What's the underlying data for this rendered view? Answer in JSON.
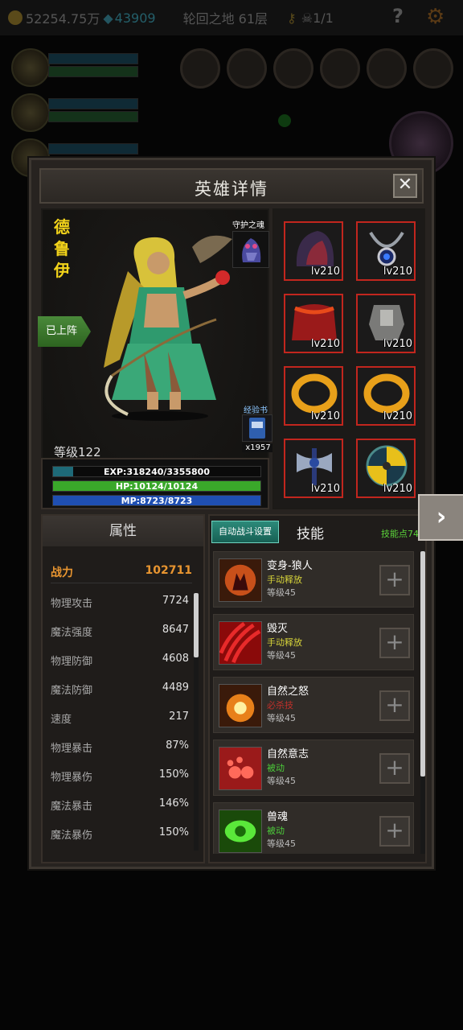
{
  "topbar": {
    "gold": "52254.75万",
    "gems": "43909",
    "floor": "轮回之地 61层",
    "keys_skulls": "1/1",
    "help_icon": "question-mark-icon",
    "settings_icon": "gear-icon"
  },
  "modal": {
    "title": "英雄详情",
    "close_icon": "close-icon"
  },
  "hero": {
    "name": "德\n鲁\n伊",
    "deployed_label": "已上阵",
    "guardian_label": "守护之魂",
    "expbook_label": "经验书",
    "expbook_count": "x1957",
    "level": "等级122",
    "exp_text": "EXP:318240/3355800",
    "exp_fraction": 0.095,
    "hp_text": "HP:10124/10124",
    "hp_fraction": 1.0,
    "mp_text": "MP:8723/8723",
    "mp_fraction": 1.0
  },
  "equipment": [
    {
      "level": "lv210",
      "icon": "hood-icon"
    },
    {
      "level": "lv210",
      "icon": "amulet-icon"
    },
    {
      "level": "lv210",
      "icon": "cape-icon"
    },
    {
      "level": "lv210",
      "icon": "armor-icon"
    },
    {
      "level": "lv210",
      "icon": "ring-icon"
    },
    {
      "level": "lv210",
      "icon": "ring-icon"
    },
    {
      "level": "lv210",
      "icon": "axe-icon"
    },
    {
      "level": "lv210",
      "icon": "shield-icon"
    }
  ],
  "attributes": {
    "tab_label": "属性",
    "power_label": "战力",
    "power_value": "102711",
    "rows": [
      {
        "label": "物理攻击",
        "value": "7724"
      },
      {
        "label": "魔法强度",
        "value": "8647"
      },
      {
        "label": "物理防御",
        "value": "4608"
      },
      {
        "label": "魔法防御",
        "value": "4489"
      },
      {
        "label": "速度",
        "value": "217"
      },
      {
        "label": "物理暴击",
        "value": "87%"
      },
      {
        "label": "物理暴伤",
        "value": "150%"
      },
      {
        "label": "魔法暴击",
        "value": "146%"
      },
      {
        "label": "魔法暴伤",
        "value": "150%"
      }
    ]
  },
  "skills": {
    "auto_battle_label": "自动战斗设置",
    "tab_label": "技能",
    "points": "技能点74",
    "items": [
      {
        "name": "变身-狼人",
        "type": "手动释放",
        "type_color": "#d7d43a",
        "level": "等级45"
      },
      {
        "name": "毁灭",
        "type": "手动释放",
        "type_color": "#d7d43a",
        "level": "等级45"
      },
      {
        "name": "自然之怒",
        "type": "必杀技",
        "type_color": "#c0302a",
        "level": "等级45"
      },
      {
        "name": "自然意志",
        "type": "被动",
        "type_color": "#4ccc3a",
        "level": "等级45"
      },
      {
        "name": "兽魂",
        "type": "被动",
        "type_color": "#4ccc3a",
        "level": "等级45"
      }
    ]
  },
  "next_icon": "chevron-right-icon"
}
